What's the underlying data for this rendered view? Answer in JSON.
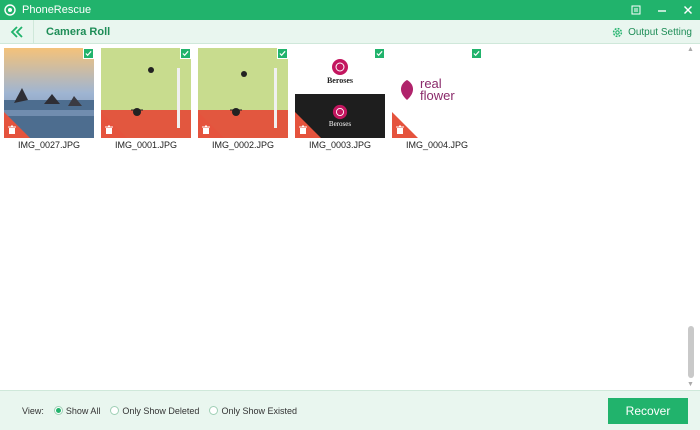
{
  "window": {
    "title": "PhoneRescue",
    "controls": [
      "menu-icon",
      "minimize-icon",
      "close-icon"
    ]
  },
  "header": {
    "title": "Camera Roll",
    "output_setting_label": "Output Setting"
  },
  "photos": [
    {
      "name": "IMG_0027.JPG",
      "kind": "landscape",
      "checked": true
    },
    {
      "name": "IMG_0001.JPG",
      "kind": "game",
      "checked": true
    },
    {
      "name": "IMG_0002.JPG",
      "kind": "game",
      "checked": true
    },
    {
      "name": "IMG_0003.JPG",
      "kind": "beroses",
      "checked": true,
      "logo_text_top": "Beroses",
      "logo_text_bottom": "Beroses"
    },
    {
      "name": "IMG_0004.JPG",
      "kind": "realflower",
      "checked": true,
      "logo_text_1": "real",
      "logo_text_2": "flower"
    }
  ],
  "footer": {
    "view_label": "View:",
    "options": [
      "Show All",
      "Only Show Deleted",
      "Only Show Existed"
    ],
    "selected_option": "Show All",
    "recover_label": "Recover"
  },
  "colors": {
    "accent": "#21b36c",
    "header_bg": "#e9f6ef",
    "delete_badge": "#e5533d"
  }
}
